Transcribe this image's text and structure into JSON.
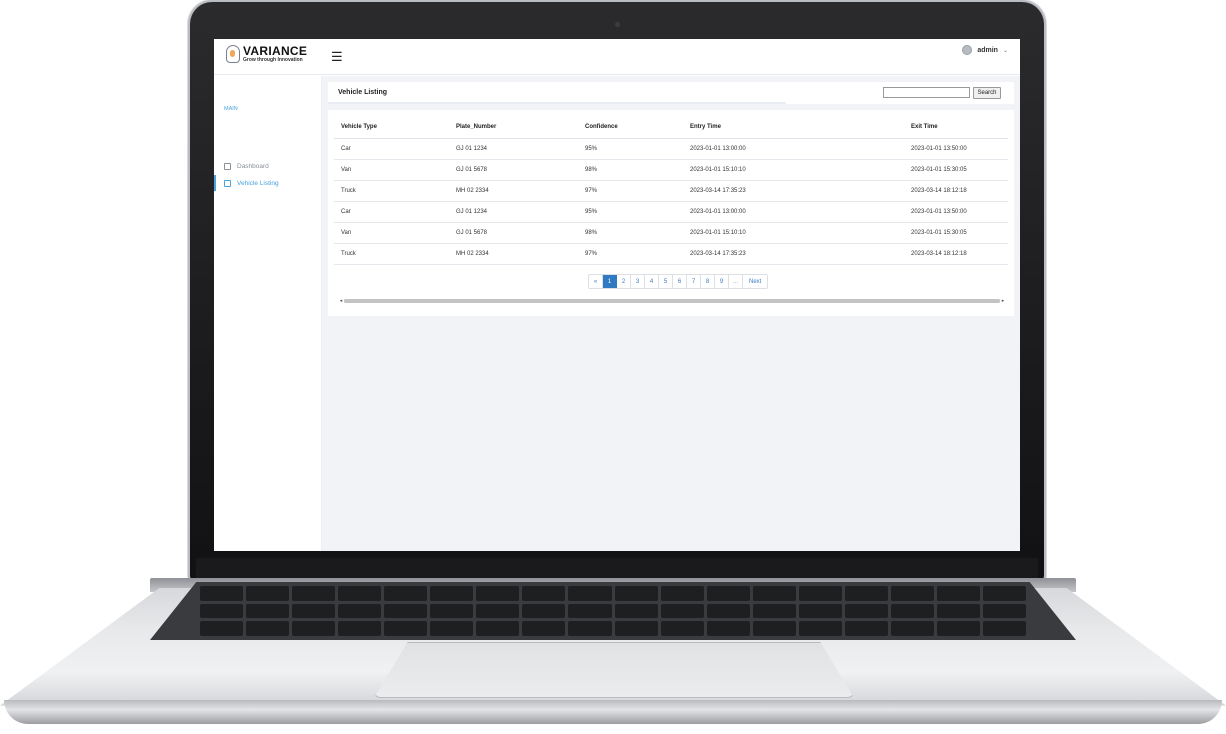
{
  "header": {
    "brand": "VARIANCE",
    "tagline": "Grow through Innovation",
    "menu_icon": "hamburger-icon",
    "user_name": "admin",
    "user_caret": "⌄"
  },
  "sidebar": {
    "section": "MAIN",
    "items": [
      {
        "label": "Dashboard",
        "icon": "home-icon"
      },
      {
        "label": "Vehicle Listing",
        "icon": "edit-icon"
      }
    ]
  },
  "page": {
    "title": "Vehicle Listing",
    "search_value": "",
    "search_button": "Search"
  },
  "table": {
    "columns": [
      "Vehicle Type",
      "Plate_Number",
      "Confidence",
      "Entry Time",
      "Exit Time"
    ],
    "rows": [
      [
        "Car",
        "GJ 01 1234",
        "95%",
        "2023-01-01 13:00:00",
        "2023-01-01 13:50:00"
      ],
      [
        "Van",
        "GJ 01 5678",
        "98%",
        "2023-01-01 15:10:10",
        "2023-01-01 15:30:05"
      ],
      [
        "Truck",
        "MH 02 2334",
        "97%",
        "2023-03-14 17:35:23",
        "2023-03-14 18:12:18"
      ],
      [
        "Car",
        "GJ 01 1234",
        "95%",
        "2023-01-01 13:00:00",
        "2023-01-01 13:50:00"
      ],
      [
        "Van",
        "GJ 01 5678",
        "98%",
        "2023-01-01 15:10:10",
        "2023-01-01 15:30:05"
      ],
      [
        "Truck",
        "MH 02 2334",
        "97%",
        "2023-03-14 17:35:23",
        "2023-03-14 18:12:18"
      ]
    ]
  },
  "pagination": {
    "prev": "«",
    "pages": [
      "1",
      "2",
      "3",
      "4",
      "5",
      "6",
      "7",
      "8",
      "9"
    ],
    "current": "1",
    "ellipsis": "...",
    "next": "Next"
  },
  "scrollbar": {
    "left": "◂",
    "right": "▸"
  },
  "colors": {
    "accent": "#4aa3df",
    "active_page": "#2f7ac0",
    "page_bg": "#f1f3f7"
  }
}
